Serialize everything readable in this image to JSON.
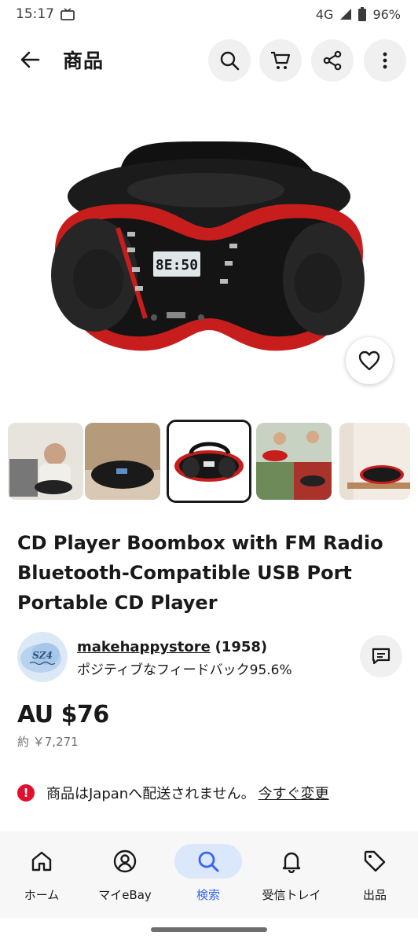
{
  "status": {
    "time": "15:17",
    "network": "4G",
    "battery": "96%"
  },
  "header": {
    "title": "商品"
  },
  "product": {
    "title_lines": [
      "CD Player Boombox with FM Radio",
      "Bluetooth-Compatible USB Port",
      "Portable CD Player"
    ],
    "display_text": "8E:50",
    "selected_thumbnail": 3,
    "thumbnail_count": 5
  },
  "seller": {
    "name": "makehappystore",
    "count": "(1958)",
    "feedback": "ポジティブなフィードバック95.6%",
    "avatar_text": "SZ4"
  },
  "price": {
    "main": "AU $76",
    "approx": "約 ￥7,271"
  },
  "shipping": {
    "notice": "商品はJapanへ配送されません。",
    "link": "今すぐ変更"
  },
  "nav": {
    "items": [
      {
        "label": "ホーム",
        "icon": "home-icon"
      },
      {
        "label": "マイeBay",
        "icon": "account-icon"
      },
      {
        "label": "検索",
        "icon": "search-icon"
      },
      {
        "label": "受信トレイ",
        "icon": "bell-icon"
      },
      {
        "label": "出品",
        "icon": "tag-icon"
      }
    ],
    "active_index": 2
  },
  "colors": {
    "accent": "#3665f3",
    "active_bg": "#dbe7fb",
    "alert": "#e0102d",
    "boombox_red": "#d21f1f"
  }
}
